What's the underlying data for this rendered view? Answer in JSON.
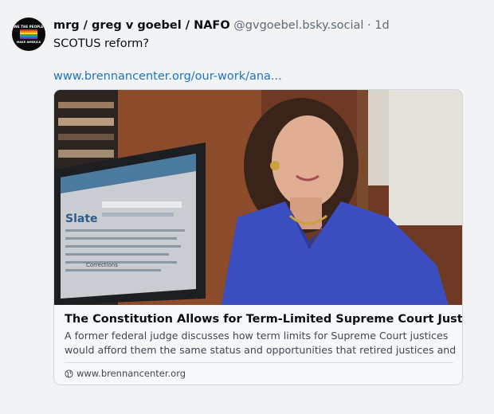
{
  "post": {
    "author_name": "mrg / greg v goebel / NAFO",
    "handle": "@gvgoebel.bsky.social",
    "separator": "·",
    "time": "1d",
    "text": "SCOTUS reform?",
    "link_text": "www.brennancenter.org/our-work/ana..."
  },
  "avatar": {
    "text_top": "WE THE PEOPLE",
    "text_bottom": "MAKE AMERICA"
  },
  "card": {
    "title": "The Constitution Allows for Term-Limited Supreme Court Justices",
    "description_line1": "A former federal judge discusses how term limits for Supreme Court justices",
    "description_line2": "would afford them the same status and opportunities that retired justices and...",
    "domain": "www.brennancenter.org",
    "image_screen_text": "Slate",
    "image_screen_subtext": "Corrections"
  },
  "colors": {
    "background": "#f1f3f5",
    "link": "#1b73c8",
    "muted": "#5d6b78",
    "blazer": "#3a4ec0"
  },
  "icons": {
    "globe": "globe-icon"
  }
}
